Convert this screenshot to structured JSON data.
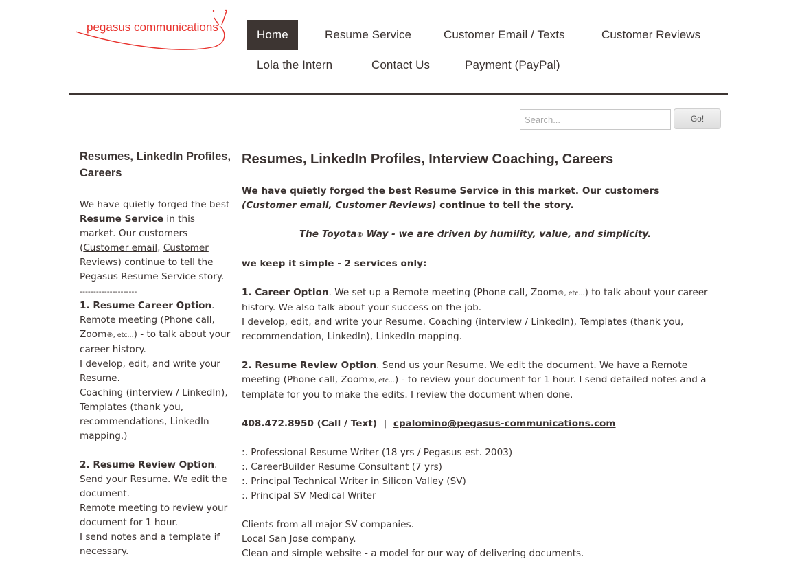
{
  "brand": {
    "logo_text": "pegasus communications",
    "logo_color": "#e8312c"
  },
  "nav": {
    "items": [
      {
        "label": "Home",
        "active": true
      },
      {
        "label": "Resume Service"
      },
      {
        "label": "Customer Email / Texts"
      },
      {
        "label": "Customer Reviews"
      },
      {
        "label": "Lola the Intern"
      },
      {
        "label": "Contact Us"
      },
      {
        "label": "Payment (PayPal)"
      }
    ],
    "active_color": "#3d3532"
  },
  "search": {
    "placeholder": "Search...",
    "value": "",
    "button_label": "Go!"
  },
  "sidebar": {
    "title": "Resumes, LinkedIn Profiles, Careers",
    "intro_1": "We have quietly forged the best ",
    "intro_bold": "Resume Service",
    "intro_2": " in this market. Our customers (",
    "link_email": "Customer email",
    "comma": ", ",
    "link_reviews": "Customer Reviews",
    "intro_3": ") continue to tell the Pegasus Resume Service story.",
    "divider": "---------------------",
    "opt1_title": "1. Resume Career Option",
    "opt1_dot": ".",
    "opt1_line1a": "Remote meeting (Phone call, Zoom",
    "reg": "®, etc...",
    "opt1_line1b": ") -  to talk about your career history.",
    "opt1_line2": "I develop, edit, and write your Resume.",
    "opt1_line3": "Coaching (interview / LinkedIn), Templates (thank you, recommendations, LinkedIn mapping.)",
    "opt2_title": "2. Resume Review Option",
    "opt2_line1": ". Send your Resume. We edit the document.",
    "opt2_line2": "Remote meeting to review your document for 1 hour.",
    "opt2_line3": "I send notes and a template if necessary."
  },
  "main": {
    "title": "Resumes, LinkedIn Profiles, Interview Coaching, Careers",
    "intro_1": "We have quietly forged the best Resume Service in this market. Our customers ",
    "link_email": "(Customer email,",
    "link_reviews": "Customer Reviews)",
    "intro_2": "  continue to tell the story.",
    "motto_1": "The Toyota",
    "motto_reg": "®",
    "motto_2": " Way - we are driven by humility, value, and simplicity.",
    "simple": "we keep it simple - 2 services only:",
    "opt1_title": "1. Career Option",
    "opt1_a": ". We set up a Remote meeting (Phone call, Zoom",
    "reg_etc": "®, etc...",
    "opt1_b": ") to talk about your career history. We also talk about your success on the job.",
    "opt1_c": "I develop, edit, and write your Resume.  Coaching (interview / LinkedIn), Templates (thank you, recommendation, LinkedIn), LinkedIn mapping.",
    "opt2_title": "2. Resume Review Option",
    "opt2_a": ". Send us your Resume. We edit the document. We have a Remote meeting (Phone call, Zoom",
    "opt2_b": ") - to review your document for 1 hour. I send detailed notes and a template for you to make the edits. I review the document when done.",
    "phone": "408.472.8950 (Call / Text)  |  ",
    "email": "cpalomino@pegasus-communications.com",
    "credentials": [
      ":.  Professional Resume Writer (18 yrs / Pegasus est. 2003)",
      ":.  CareerBuilder Resume Consultant (7 yrs)",
      ":.  Principal Technical Writer in Silicon Valley (SV)",
      ":.  Principal SV Medical Writer"
    ],
    "closing": [
      "Clients from all major SV companies.",
      "Local San Jose company.",
      "Clean and simple website - a model for our way of delivering documents."
    ]
  }
}
